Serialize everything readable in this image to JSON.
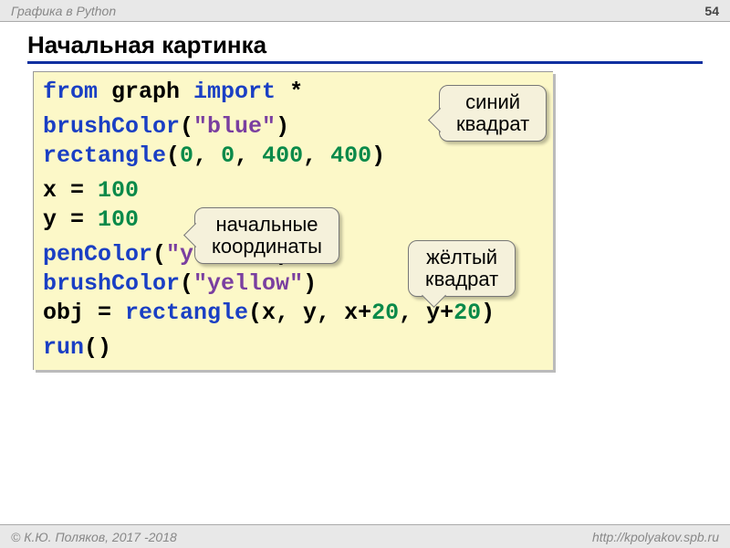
{
  "header": {
    "topic": "Графика в Python",
    "page": "54"
  },
  "title": "Начальная картинка",
  "code": {
    "l1": {
      "a": "from",
      "b": " graph ",
      "c": "import",
      "d": " *"
    },
    "l2": {
      "a": "brushColor",
      "b": "(",
      "c": "\"blue\"",
      "d": ")"
    },
    "l3": {
      "a": "rectangle",
      "b": "(",
      "n1": "0",
      "c1": ", ",
      "n2": "0",
      "c2": ", ",
      "n3": "400",
      "c3": ", ",
      "n4": "400",
      "d": ")"
    },
    "l4": {
      "a": "x = ",
      "n": "100"
    },
    "l5": {
      "a": "y = ",
      "n": "100"
    },
    "l6": {
      "a": "penColor",
      "b": "(",
      "c": "\"yellow\"",
      "d": ")"
    },
    "l7": {
      "a": "brushColor",
      "b": "(",
      "c": "\"yellow\"",
      "d": ")"
    },
    "l8": {
      "a": "obj = ",
      "b": "rectangle",
      "c": "(x, y, x+",
      "n1": "20",
      "d": ", y+",
      "n2": "20",
      "e": ")"
    },
    "l9": {
      "a": "run",
      "b": "()"
    }
  },
  "callouts": {
    "blue_square": "синий\nквадрат",
    "initial_coords": "начальные\nкоординаты",
    "yellow_square": "жёлтый\nквадрат"
  },
  "footer": {
    "left": "© К.Ю. Поляков, 2017 -2018",
    "right": "http://kpolyakov.spb.ru"
  }
}
